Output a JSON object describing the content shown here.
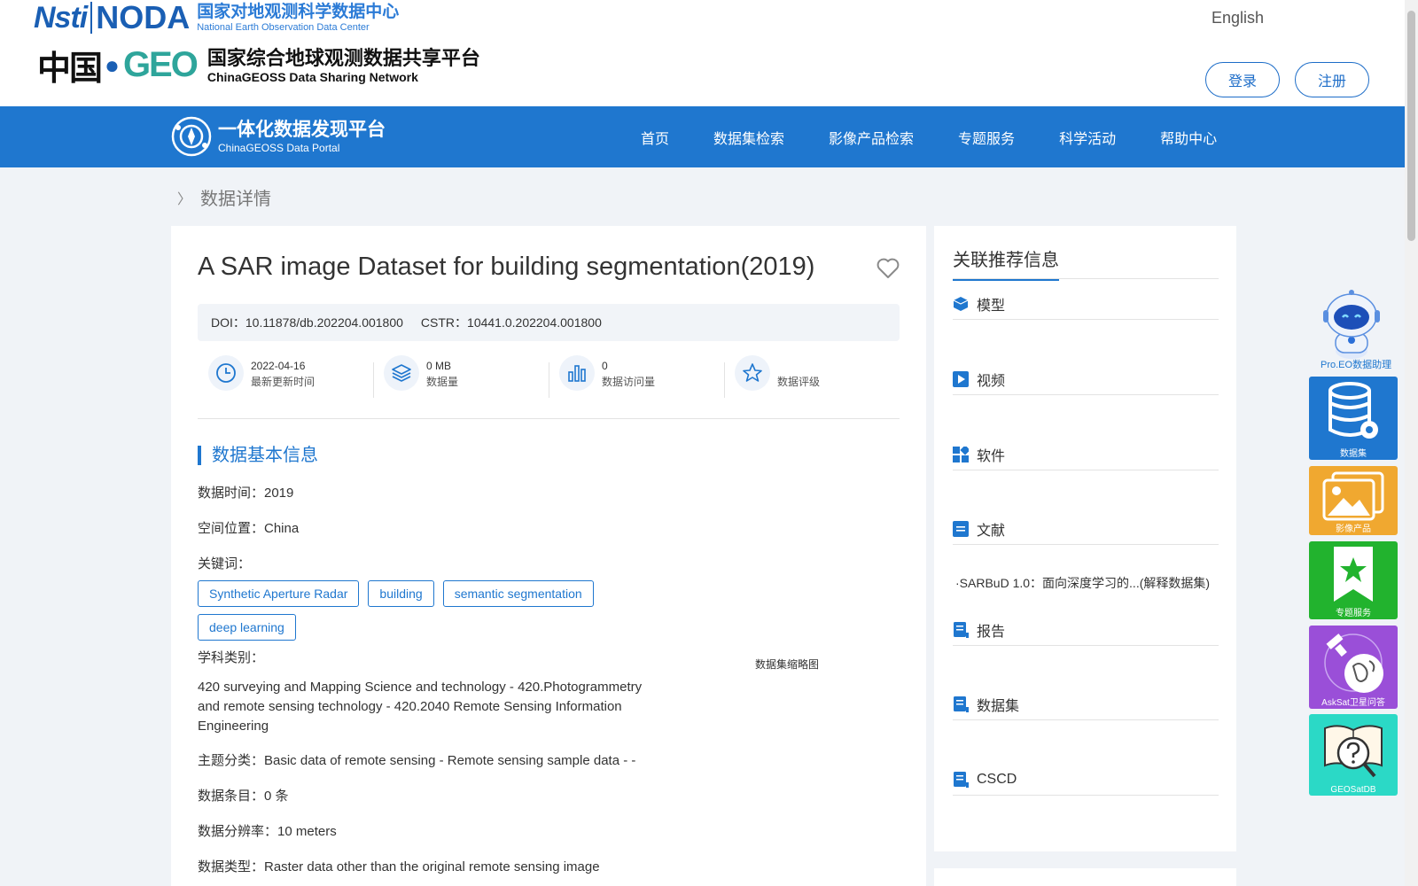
{
  "header": {
    "noda_logo_mark": "Nsti NODA",
    "noda_cn": "国家对地观测科学数据中心",
    "noda_en": "National Earth Observation Data Center",
    "geo_cn_big": "中国",
    "geo_mark": "GEO",
    "geo_cn": "国家综合地球观测数据共享平台",
    "geo_en": "ChinaGEOSS Data Sharing Network",
    "language": "English",
    "login": "登录",
    "register": "注册"
  },
  "nav": {
    "portal_cn": "一体化数据发现平台",
    "portal_en": "ChinaGEOSS Data Portal",
    "items": [
      "首页",
      "数据集检索",
      "影像产品检索",
      "专题服务",
      "科学活动",
      "帮助中心"
    ]
  },
  "breadcrumb": "数据详情",
  "dataset": {
    "title": "A SAR image Dataset for building segmentation(2019)",
    "doi": "DOI：10.11878/db.202204.001800",
    "cstr": "CSTR：10441.0.202204.001800",
    "stats": [
      {
        "value": "2022-04-16",
        "label": "最新更新时间",
        "icon": "clock-icon"
      },
      {
        "value": "0 MB",
        "label": "数据量",
        "icon": "layers-icon"
      },
      {
        "value": "0",
        "label": "数据访问量",
        "icon": "bar-chart-icon"
      },
      {
        "value": "",
        "label": "数据评级",
        "icon": "star-icon"
      }
    ],
    "section_title": "数据基本信息",
    "data_time": "数据时间：2019",
    "location": "空间位置：China",
    "keywords_label": "关键词：",
    "keywords": [
      "Synthetic Aperture Radar",
      "building",
      "semantic segmentation",
      "deep learning"
    ],
    "discipline_label": "学科类别：",
    "discipline": "420 surveying and Mapping Science and technology - 420.Photogrammetry and remote sensing technology - 420.2040 Remote Sensing Information Engineering",
    "thumbnail_label": "数据集缩略图",
    "topic": "主题分类：Basic data of remote sensing - Remote sensing sample data - -",
    "entries": "数据条目：0 条",
    "resolution": "数据分辨率：10 meters",
    "data_type": "数据类型：Raster data other than the original remote sensing image"
  },
  "related": {
    "title": "关联推荐信息",
    "sections": [
      "模型",
      "视频",
      "软件",
      "文献",
      "报告",
      "数据集",
      "CSCD"
    ],
    "literature_link": "·SARBuD 1.0：面向深度学习的...(解释数据集)"
  },
  "float_tools": {
    "assistant": "Pro.EO数据助理",
    "dataset": "数据集",
    "imagery": "影像产品",
    "topic": "专题服务",
    "asksat": "AskSat卫星问答",
    "geosatdb": "GEOSatDB"
  },
  "colors": {
    "primary": "#1f77cf",
    "background": "#f0f3f7",
    "dataset_tool": "#1f77cf",
    "imagery_tool": "#f0a830",
    "topic_tool": "#22b32e",
    "asksat_tool": "#9a4fd8",
    "geosatdb_tool": "#2bd9c6"
  }
}
